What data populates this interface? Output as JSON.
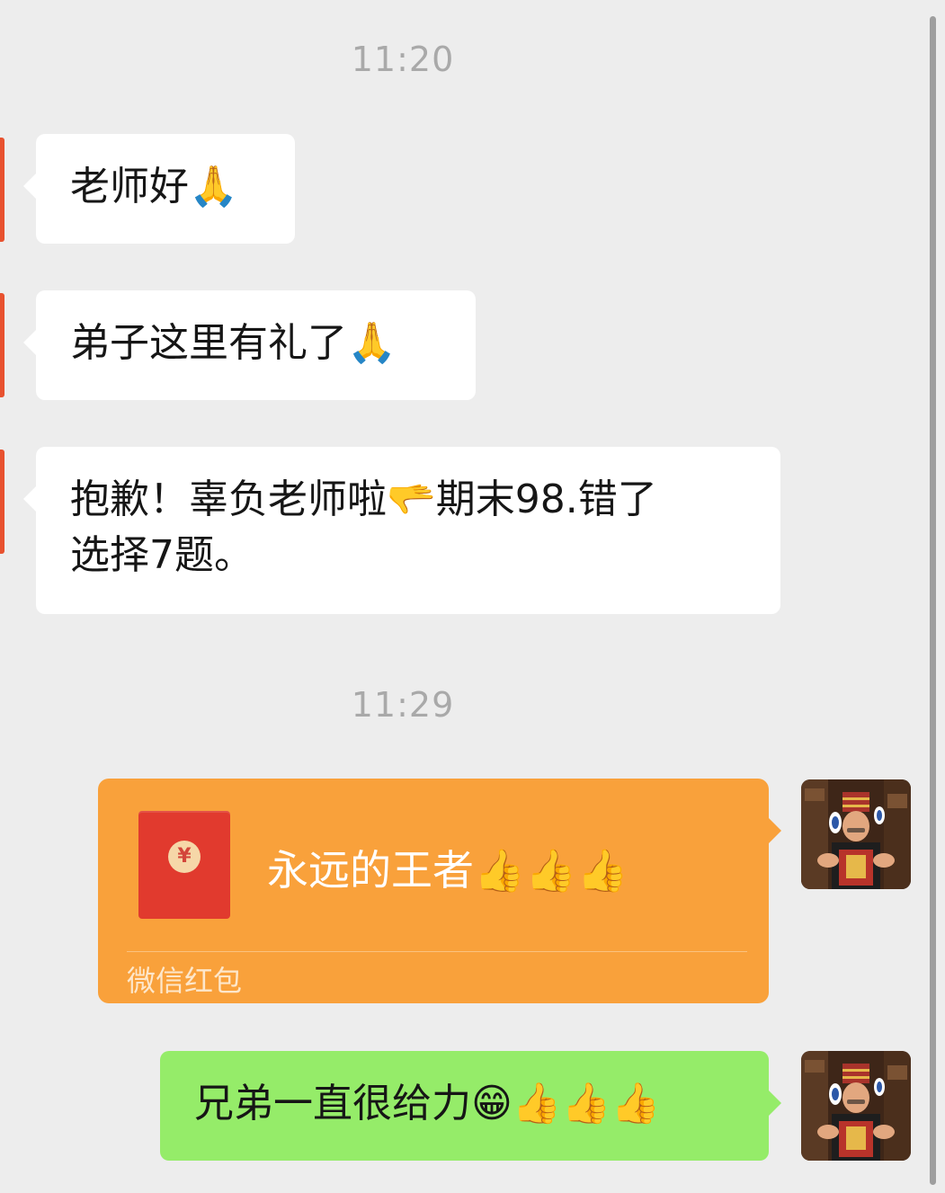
{
  "chat": {
    "timestamps": [
      "11:20",
      "11:29"
    ],
    "incoming_messages": [
      {
        "text": "老师好🙏"
      },
      {
        "text": "弟子这里有礼了🙏"
      },
      {
        "line1": "抱歉！辜负老师啦🫳期末98.错了",
        "line2": "选择7题。"
      }
    ],
    "red_packet": {
      "title": "永远的王者👍👍👍",
      "footer": "微信红包",
      "icon": "yuan-icon",
      "coin_symbol": "¥",
      "color": "#f9a13b"
    },
    "outgoing_message": {
      "text": "兄弟一直很给力😁👍👍👍",
      "color": "#95ec69"
    }
  }
}
